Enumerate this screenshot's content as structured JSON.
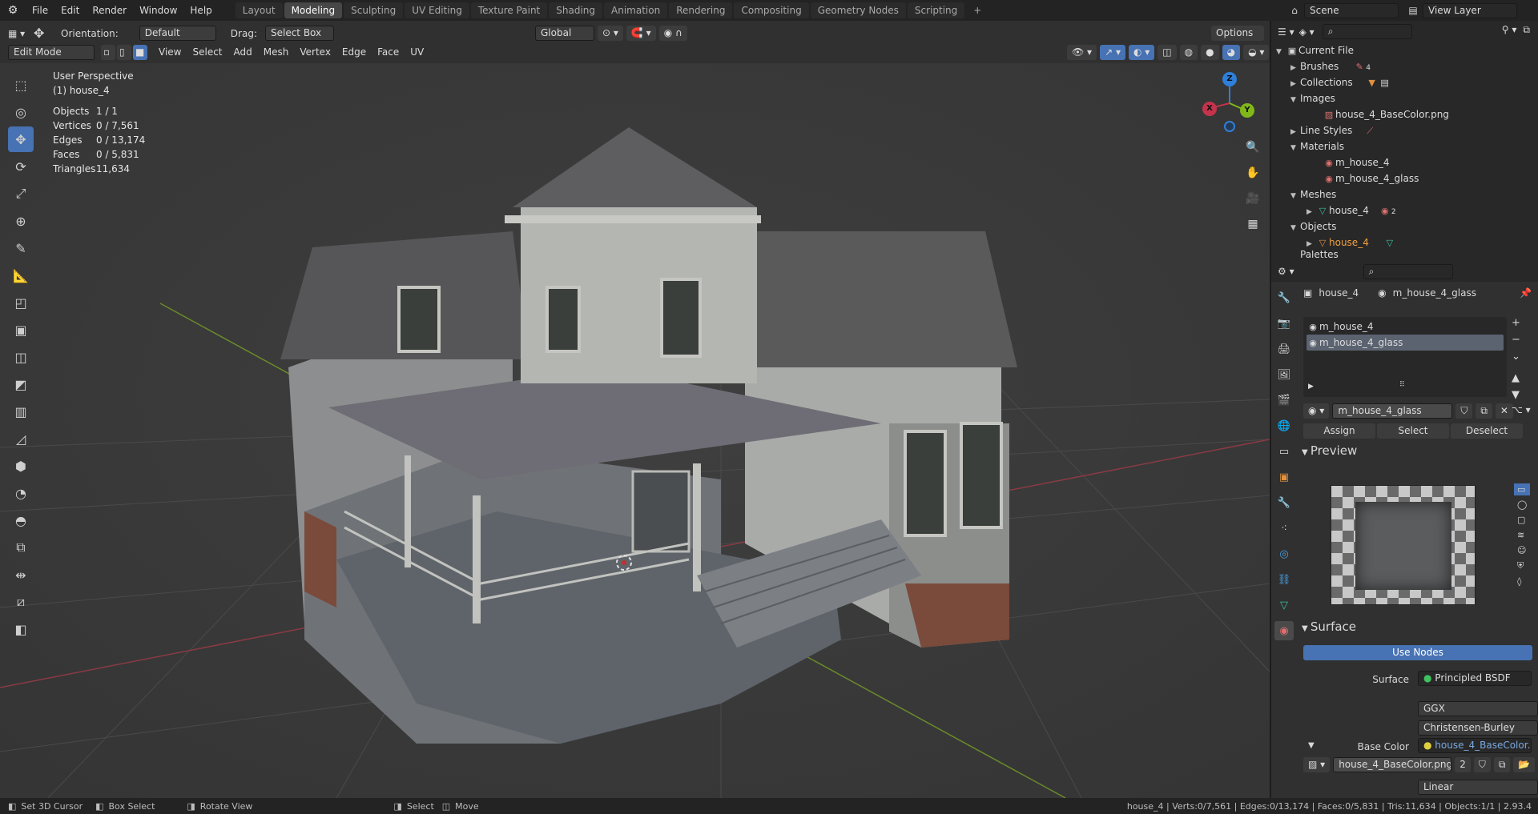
{
  "menus": [
    "File",
    "Edit",
    "Render",
    "Window",
    "Help"
  ],
  "workspaces": [
    {
      "label": "Layout",
      "active": false
    },
    {
      "label": "Modeling",
      "active": true
    },
    {
      "label": "Sculpting",
      "active": false
    },
    {
      "label": "UV Editing",
      "active": false
    },
    {
      "label": "Texture Paint",
      "active": false
    },
    {
      "label": "Shading",
      "active": false
    },
    {
      "label": "Animation",
      "active": false
    },
    {
      "label": "Rendering",
      "active": false
    },
    {
      "label": "Compositing",
      "active": false
    },
    {
      "label": "Geometry Nodes",
      "active": false
    },
    {
      "label": "Scripting",
      "active": false
    }
  ],
  "add_workspace": "+",
  "scene": {
    "label": "Scene",
    "view_layer": "View Layer"
  },
  "header": {
    "orientation_label": "Orientation:",
    "orientation_value": "Default",
    "drag_label": "Drag:",
    "drag_value": "Select Box",
    "transform_value": "Global",
    "options_label": "Options"
  },
  "editor_header": {
    "mode": "Edit Mode",
    "menus": [
      "View",
      "Select",
      "Add",
      "Mesh",
      "Vertex",
      "Edge",
      "Face",
      "UV"
    ],
    "xyz": [
      "X",
      "Y",
      "Z"
    ]
  },
  "viewport": {
    "view_name": "User Perspective",
    "object_name": "(1) house_4",
    "stats": [
      {
        "key": "Objects",
        "value": "1 / 1"
      },
      {
        "key": "Vertices",
        "value": "0 / 7,561"
      },
      {
        "key": "Edges",
        "value": "0 / 13,174"
      },
      {
        "key": "Faces",
        "value": "0 / 5,831"
      },
      {
        "key": "Triangles",
        "value": "11,634"
      }
    ],
    "gizmo": {
      "x": "X",
      "y": "Y",
      "z": "Z"
    }
  },
  "tools": [
    "select-box",
    "cursor",
    "move",
    "rotate",
    "scale",
    "transform",
    "annotate",
    "measure",
    "add-cube",
    "extrude",
    "inset",
    "bevel",
    "loop-cut",
    "knife",
    "poly-build",
    "spin",
    "smooth",
    "edge-slide",
    "shrink-fatten",
    "shear",
    "rip"
  ],
  "outliner": {
    "root": "Current File",
    "items": [
      {
        "label": "Brushes",
        "badge": "4",
        "indent": 1
      },
      {
        "label": "Collections",
        "indent": 1
      },
      {
        "label": "Images",
        "indent": 1
      },
      {
        "label": "house_4_BaseColor.png",
        "indent": 2
      },
      {
        "label": "Line Styles",
        "indent": 1
      },
      {
        "label": "Materials",
        "indent": 1
      },
      {
        "label": "m_house_4",
        "indent": 2
      },
      {
        "label": "m_house_4_glass",
        "indent": 2
      },
      {
        "label": "Meshes",
        "indent": 1
      },
      {
        "label": "house_4",
        "badge": "2",
        "indent": 2
      },
      {
        "label": "Objects",
        "indent": 1
      },
      {
        "label": "house_4",
        "indent": 2,
        "highlight": true
      },
      {
        "label": "Palettes",
        "indent": 1
      }
    ]
  },
  "properties": {
    "breadcrumb_object": "house_4",
    "breadcrumb_material": "m_house_4_glass",
    "slots": [
      {
        "label": "m_house_4",
        "selected": false
      },
      {
        "label": "m_house_4_glass",
        "selected": true
      }
    ],
    "material_name": "m_house_4_glass",
    "assign": "Assign",
    "select": "Select",
    "deselect": "Deselect",
    "preview_title": "Preview",
    "surface_title": "Surface",
    "use_nodes": "Use Nodes",
    "surface_label": "Surface",
    "surface_value": "Principled BSDF",
    "distribution": "GGX",
    "subsurface": "Christensen-Burley",
    "base_color_label": "Base Color",
    "base_color_value": "house_4_BaseColor.png",
    "image_name": "house_4_BaseColor.png",
    "image_users": "2",
    "interpolation": "Linear"
  },
  "statusbar": {
    "hints": [
      "Set 3D Cursor",
      "Box Select",
      "Rotate View",
      "Select",
      "Move"
    ],
    "info": "house_4 | Verts:0/7,561 | Edges:0/13,174 | Faces:0/5,831 | Tris:11,634 | Objects:1/1 | 2.93.4"
  },
  "colors": {
    "accent": "#4772b3",
    "x_axis": "#c3334c",
    "y_axis": "#80b81a",
    "z_axis": "#2f7fd9"
  }
}
